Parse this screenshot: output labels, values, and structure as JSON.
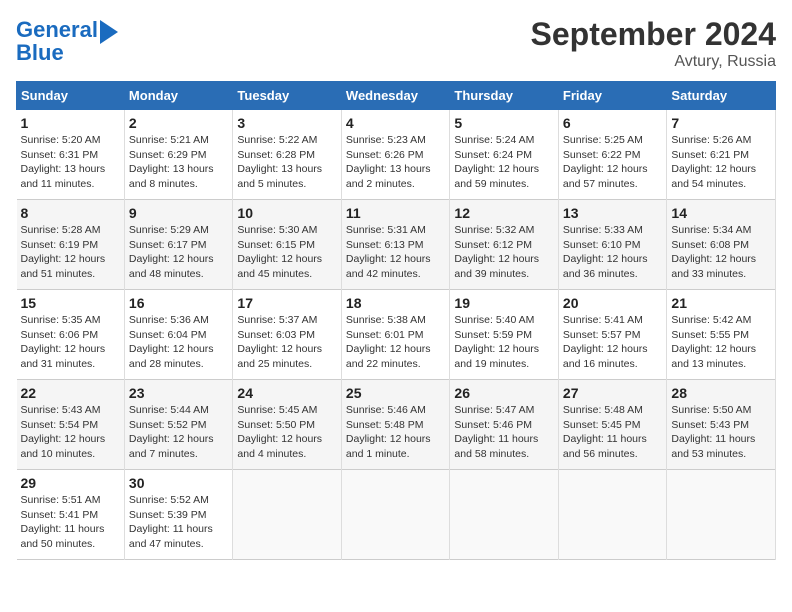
{
  "header": {
    "logo_line1": "General",
    "logo_line2": "Blue",
    "month": "September 2024",
    "location": "Avtury, Russia"
  },
  "days_of_week": [
    "Sunday",
    "Monday",
    "Tuesday",
    "Wednesday",
    "Thursday",
    "Friday",
    "Saturday"
  ],
  "weeks": [
    [
      {
        "day": "1",
        "detail": "Sunrise: 5:20 AM\nSunset: 6:31 PM\nDaylight: 13 hours\nand 11 minutes."
      },
      {
        "day": "2",
        "detail": "Sunrise: 5:21 AM\nSunset: 6:29 PM\nDaylight: 13 hours\nand 8 minutes."
      },
      {
        "day": "3",
        "detail": "Sunrise: 5:22 AM\nSunset: 6:28 PM\nDaylight: 13 hours\nand 5 minutes."
      },
      {
        "day": "4",
        "detail": "Sunrise: 5:23 AM\nSunset: 6:26 PM\nDaylight: 13 hours\nand 2 minutes."
      },
      {
        "day": "5",
        "detail": "Sunrise: 5:24 AM\nSunset: 6:24 PM\nDaylight: 12 hours\nand 59 minutes."
      },
      {
        "day": "6",
        "detail": "Sunrise: 5:25 AM\nSunset: 6:22 PM\nDaylight: 12 hours\nand 57 minutes."
      },
      {
        "day": "7",
        "detail": "Sunrise: 5:26 AM\nSunset: 6:21 PM\nDaylight: 12 hours\nand 54 minutes."
      }
    ],
    [
      {
        "day": "8",
        "detail": "Sunrise: 5:28 AM\nSunset: 6:19 PM\nDaylight: 12 hours\nand 51 minutes."
      },
      {
        "day": "9",
        "detail": "Sunrise: 5:29 AM\nSunset: 6:17 PM\nDaylight: 12 hours\nand 48 minutes."
      },
      {
        "day": "10",
        "detail": "Sunrise: 5:30 AM\nSunset: 6:15 PM\nDaylight: 12 hours\nand 45 minutes."
      },
      {
        "day": "11",
        "detail": "Sunrise: 5:31 AM\nSunset: 6:13 PM\nDaylight: 12 hours\nand 42 minutes."
      },
      {
        "day": "12",
        "detail": "Sunrise: 5:32 AM\nSunset: 6:12 PM\nDaylight: 12 hours\nand 39 minutes."
      },
      {
        "day": "13",
        "detail": "Sunrise: 5:33 AM\nSunset: 6:10 PM\nDaylight: 12 hours\nand 36 minutes."
      },
      {
        "day": "14",
        "detail": "Sunrise: 5:34 AM\nSunset: 6:08 PM\nDaylight: 12 hours\nand 33 minutes."
      }
    ],
    [
      {
        "day": "15",
        "detail": "Sunrise: 5:35 AM\nSunset: 6:06 PM\nDaylight: 12 hours\nand 31 minutes."
      },
      {
        "day": "16",
        "detail": "Sunrise: 5:36 AM\nSunset: 6:04 PM\nDaylight: 12 hours\nand 28 minutes."
      },
      {
        "day": "17",
        "detail": "Sunrise: 5:37 AM\nSunset: 6:03 PM\nDaylight: 12 hours\nand 25 minutes."
      },
      {
        "day": "18",
        "detail": "Sunrise: 5:38 AM\nSunset: 6:01 PM\nDaylight: 12 hours\nand 22 minutes."
      },
      {
        "day": "19",
        "detail": "Sunrise: 5:40 AM\nSunset: 5:59 PM\nDaylight: 12 hours\nand 19 minutes."
      },
      {
        "day": "20",
        "detail": "Sunrise: 5:41 AM\nSunset: 5:57 PM\nDaylight: 12 hours\nand 16 minutes."
      },
      {
        "day": "21",
        "detail": "Sunrise: 5:42 AM\nSunset: 5:55 PM\nDaylight: 12 hours\nand 13 minutes."
      }
    ],
    [
      {
        "day": "22",
        "detail": "Sunrise: 5:43 AM\nSunset: 5:54 PM\nDaylight: 12 hours\nand 10 minutes."
      },
      {
        "day": "23",
        "detail": "Sunrise: 5:44 AM\nSunset: 5:52 PM\nDaylight: 12 hours\nand 7 minutes."
      },
      {
        "day": "24",
        "detail": "Sunrise: 5:45 AM\nSunset: 5:50 PM\nDaylight: 12 hours\nand 4 minutes."
      },
      {
        "day": "25",
        "detail": "Sunrise: 5:46 AM\nSunset: 5:48 PM\nDaylight: 12 hours\nand 1 minute."
      },
      {
        "day": "26",
        "detail": "Sunrise: 5:47 AM\nSunset: 5:46 PM\nDaylight: 11 hours\nand 58 minutes."
      },
      {
        "day": "27",
        "detail": "Sunrise: 5:48 AM\nSunset: 5:45 PM\nDaylight: 11 hours\nand 56 minutes."
      },
      {
        "day": "28",
        "detail": "Sunrise: 5:50 AM\nSunset: 5:43 PM\nDaylight: 11 hours\nand 53 minutes."
      }
    ],
    [
      {
        "day": "29",
        "detail": "Sunrise: 5:51 AM\nSunset: 5:41 PM\nDaylight: 11 hours\nand 50 minutes."
      },
      {
        "day": "30",
        "detail": "Sunrise: 5:52 AM\nSunset: 5:39 PM\nDaylight: 11 hours\nand 47 minutes."
      },
      {
        "day": "",
        "detail": ""
      },
      {
        "day": "",
        "detail": ""
      },
      {
        "day": "",
        "detail": ""
      },
      {
        "day": "",
        "detail": ""
      },
      {
        "day": "",
        "detail": ""
      }
    ]
  ]
}
